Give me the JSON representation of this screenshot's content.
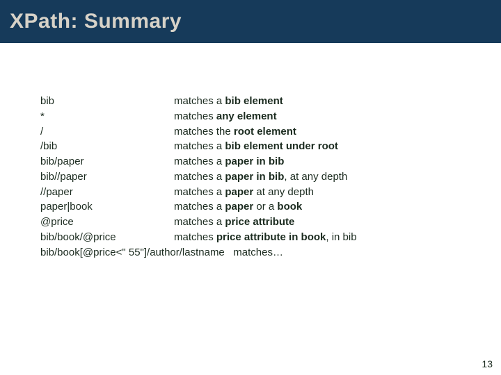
{
  "title": "XPath: Summary",
  "rows": [
    {
      "lhs": "bib",
      "pre": "matches a ",
      "b": "bib element",
      "post": ""
    },
    {
      "lhs": "*",
      "pre": "matches ",
      "b": "any element",
      "post": ""
    },
    {
      "lhs": "/",
      "pre": "matches the ",
      "b": "root element",
      "post": ""
    },
    {
      "lhs": "/bib",
      "pre": "matches a ",
      "b": "bib element under root",
      "post": ""
    },
    {
      "lhs": "bib/paper",
      "pre": "matches a ",
      "b": "paper in bib",
      "post": ""
    },
    {
      "lhs": "bib//paper",
      "pre": "matches a ",
      "b": "paper in bib",
      "post": ", at any depth"
    },
    {
      "lhs": "//paper",
      "pre": "matches a ",
      "b": "paper",
      "post": " at any depth"
    },
    {
      "lhs": "paper|book",
      "pre": "matches a ",
      "b": "paper",
      "post": " or a ",
      "b2": "book"
    },
    {
      "lhs": "@price",
      "pre": "matches a ",
      "b": "price attribute",
      "post": ""
    },
    {
      "lhs": "bib/book/@price",
      "pre": "matches ",
      "b": "price attribute in book",
      "post": ", in bib"
    }
  ],
  "last": {
    "text": "bib/book[@price<\" 55\"]/author/lastname   matches…"
  },
  "page_number": "13"
}
